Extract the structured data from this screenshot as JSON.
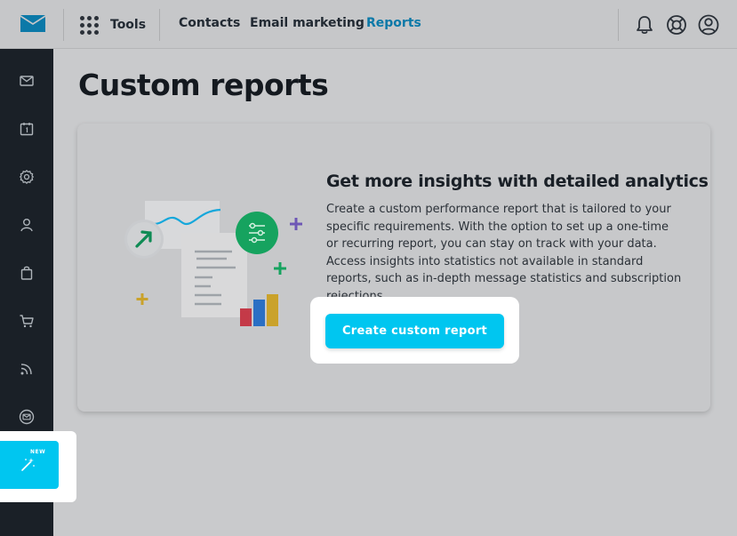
{
  "header": {
    "logo_icon": "envelope-logo-icon",
    "tools_label": "Tools",
    "nav": [
      {
        "label": "Contacts",
        "active": false
      },
      {
        "label": "Email marketing",
        "active": false
      },
      {
        "label": "Reports",
        "active": true
      }
    ],
    "icons": [
      "bell-icon",
      "help-lifebuoy-icon",
      "account-icon"
    ],
    "active_color": "#0b79a8"
  },
  "sidebar": {
    "items": [
      {
        "icon": "mail-icon"
      },
      {
        "icon": "calendar-icon"
      },
      {
        "icon": "gear-icon"
      },
      {
        "icon": "contacts-icon"
      },
      {
        "icon": "shopping-bag-icon"
      },
      {
        "icon": "shopping-cart-icon"
      },
      {
        "icon": "rss-icon"
      },
      {
        "icon": "mail-circle-icon"
      }
    ],
    "new_item": {
      "badge": "NEW",
      "icon": "magic-wand-icon"
    },
    "background": "#1a2027"
  },
  "main": {
    "title": "Custom reports",
    "card": {
      "heading": "Get more insights with detailed analytics",
      "description": "Create a custom performance report that is tailored to your specific requirements. With the option to set up a one-time or recurring report, you can stay on track with your data. Access insights into statistics not available in standard reports, such as in-depth message statistics and subscription rejections.",
      "button_label": "Create custom report",
      "accent": "#00c6f0"
    }
  }
}
